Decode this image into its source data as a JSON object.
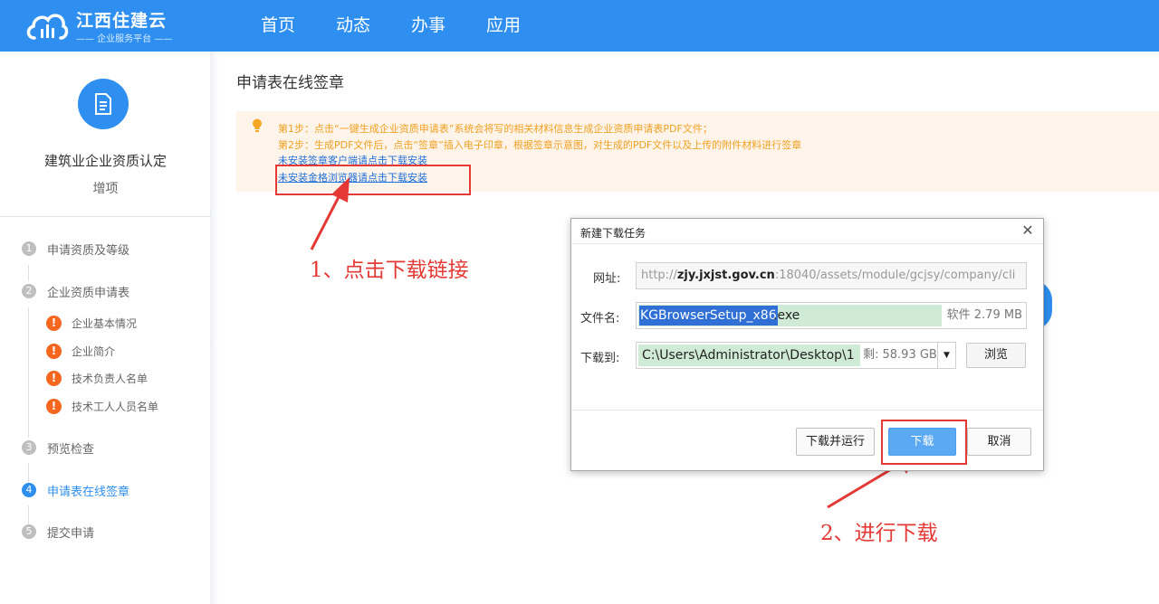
{
  "header": {
    "logo_title": "江西住建云",
    "logo_subtitle": "—— 企业服务平台 ——",
    "nav": [
      "首页",
      "动态",
      "办事",
      "应用"
    ]
  },
  "sidebar": {
    "title": "建筑业企业资质认定",
    "subtitle": "增项",
    "steps": [
      {
        "num": "1",
        "label": "申请资质及等级"
      },
      {
        "num": "2",
        "label": "企业资质申请表"
      },
      {
        "num": "3",
        "label": "预览检查"
      },
      {
        "num": "4",
        "label": "申请表在线签章"
      },
      {
        "num": "5",
        "label": "提交申请"
      }
    ],
    "sub_steps": [
      "企业基本情况",
      "企业简介",
      "技术负责人名单",
      "技术工人人员名单"
    ],
    "warn_glyph": "!"
  },
  "main": {
    "page_title": "申请表在线签章",
    "notice": {
      "line1": "第1步：点击“一键生成企业资质申请表”系统会将写的相关材料信息生成企业资质申请表PDF文件；",
      "line2": "第2步：生成PDF文件后，点击“签章”插入电子印章，根据签章示意图，对生成的PDF文件以及上传的附件材料进行签章",
      "link1": "未安装签章客户端请点击下载安装",
      "link2": "未安装金格浏览器请点击下载安装"
    },
    "annotation1": "1、点击下载链接",
    "annotation2": "2、进行下载"
  },
  "dialog": {
    "title": "新建下载任务",
    "close": "✕",
    "url_label": "网址:",
    "url_prefix": "http://",
    "url_host": "zjy.jxjst.gov.cn",
    "url_rest": ":18040/assets/module/gcjsy/company/cli",
    "name_label": "文件名:",
    "file_name": "KGBrowserSetup_x86",
    "file_ext": ".exe",
    "file_size": "软件 2.79 MB",
    "path_label": "下载到:",
    "path": "C:\\Users\\Administrator\\Desktop\\1",
    "free_space": "剩: 58.93 GB",
    "dropdown": "▼",
    "browse": "浏览",
    "download_run": "下载并运行",
    "download": "下载",
    "cancel": "取消"
  },
  "colors": {
    "brand_blue": "#2e8ff0",
    "notice_orange": "#f0a020",
    "annotation_red": "#e53935",
    "warn_orange": "#f5661e"
  }
}
